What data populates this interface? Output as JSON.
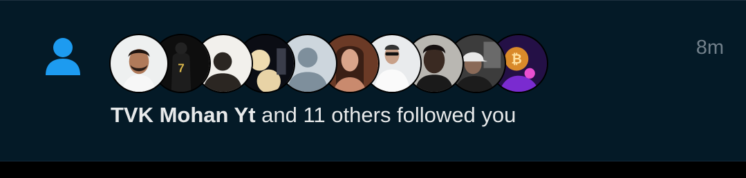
{
  "notification": {
    "type_icon": "person-icon",
    "accent_color": "#1d9bf0",
    "timestamp": "8m",
    "actor_name": "TVK Mohan Yt",
    "message_rest": " and 11 others followed you",
    "avatars": [
      {
        "icon": "avatar-man-with-beard"
      },
      {
        "icon": "avatar-jersey-number-7"
      },
      {
        "icon": "avatar-dark-figure"
      },
      {
        "icon": "avatar-full-moon"
      },
      {
        "icon": "avatar-default-placeholder"
      },
      {
        "icon": "avatar-woman-portrait"
      },
      {
        "icon": "avatar-man-in-white-suit"
      },
      {
        "icon": "avatar-young-man-portrait"
      },
      {
        "icon": "avatar-man-in-cap"
      },
      {
        "icon": "avatar-crypto-art"
      }
    ]
  }
}
